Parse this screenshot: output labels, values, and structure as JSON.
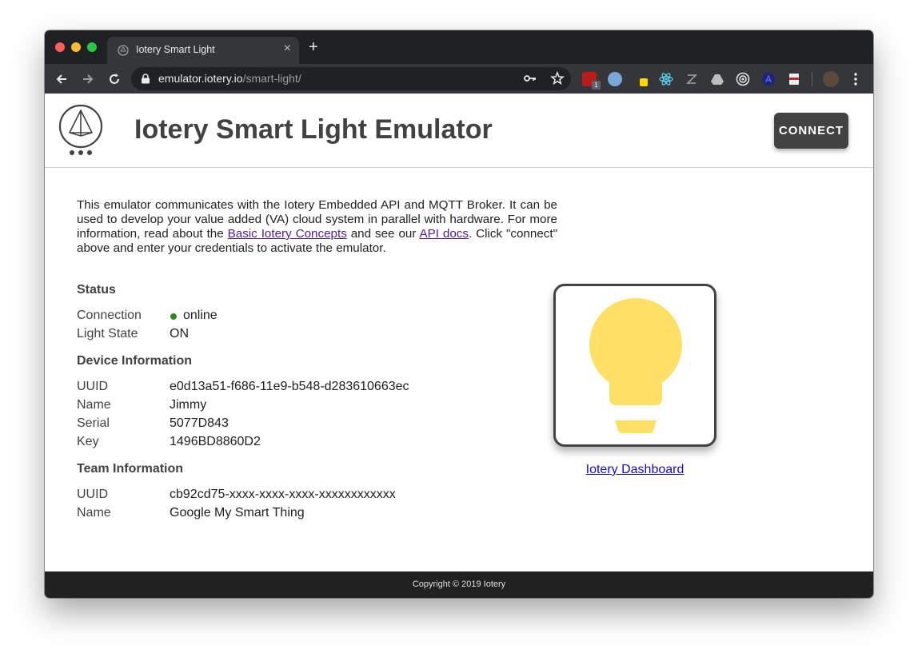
{
  "browser": {
    "tab_title": "Iotery Smart Light",
    "tab_close": "×",
    "new_tab": "+",
    "url_host": "emulator.iotery.io",
    "url_path": "/smart-light/",
    "ext_badge": "1",
    "icons": [
      "back-arrow-icon",
      "forward-arrow-icon",
      "reload-icon",
      "lock-icon",
      "key-icon",
      "star-icon",
      "menu-dots-icon"
    ]
  },
  "header": {
    "title": "Iotery Smart Light Emulator",
    "connect_label": "CONNECT"
  },
  "intro": {
    "text_1": "This emulator communicates with the Iotery Embedded API and MQTT Broker. It can be used to develop your value added (VA) cloud system in parallel with hardware. For more information, read about the ",
    "link_concepts": "Basic Iotery Concepts",
    "text_2": " and see our ",
    "link_api": "API docs",
    "text_3": ". Click \"connect\" above and enter your credentials to activate the emulator."
  },
  "status": {
    "heading": "Status",
    "connection_label": "Connection",
    "connection_value": "online",
    "light_state_label": "Light State",
    "light_state_value": "ON"
  },
  "device": {
    "heading": "Device Information",
    "uuid_label": "UUID",
    "uuid_value": "e0d13a51-f686-11e9-b548-d283610663ec",
    "name_label": "Name",
    "name_value": "Jimmy",
    "serial_label": "Serial",
    "serial_value": "5077D843",
    "key_label": "Key",
    "key_value": "1496BD8860D2"
  },
  "team": {
    "heading": "Team Information",
    "uuid_label": "UUID",
    "uuid_value": "cb92cd75-xxxx-xxxx-xxxx-xxxxxxxxxxxx",
    "name_label": "Name",
    "name_value": "Google My Smart Thing"
  },
  "dashboard_link": "Iotery Dashboard",
  "footer": "Copyright © 2019 Iotery",
  "colors": {
    "bulb": "#ffe066",
    "online": "#2e8b1e",
    "header_dark": "#424242",
    "footer_bg": "#212121"
  }
}
